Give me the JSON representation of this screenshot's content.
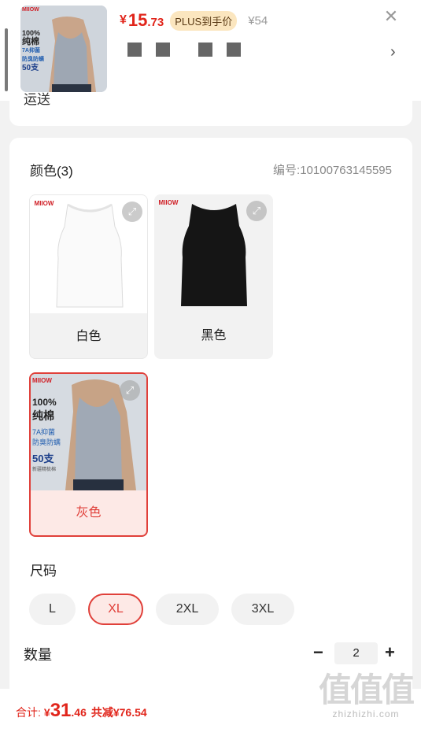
{
  "header": {
    "price_currency": "¥",
    "price_int": "15",
    "price_dec": ".73",
    "plus_tag": "PLUS到手价",
    "original_price": "¥54",
    "close_icon": "close-icon",
    "chevron_icon": "chevron-right-icon",
    "cut_text": "运送"
  },
  "thumb": {
    "brand": "MIIOW",
    "text_100": "100%",
    "text_cotton": "纯棉",
    "text_7a": "7A抑菌",
    "text_anti": "防臭防螨",
    "text_50": "50支",
    "text_new": "新疆精梳棉"
  },
  "color_section": {
    "title": "颜色(3)",
    "code": "编号:10100763145595",
    "options": [
      {
        "label": "白色",
        "selected": false
      },
      {
        "label": "黑色",
        "selected": false
      },
      {
        "label": "灰色",
        "selected": true
      }
    ]
  },
  "size_section": {
    "title": "尺码",
    "options": [
      {
        "label": "L",
        "selected": false
      },
      {
        "label": "XL",
        "selected": true
      },
      {
        "label": "2XL",
        "selected": false
      },
      {
        "label": "3XL",
        "selected": false
      }
    ]
  },
  "quantity": {
    "label": "数量",
    "value": "2",
    "minus": "−",
    "plus": "+"
  },
  "footer": {
    "total_label": "合计:",
    "currency": "¥",
    "total_int": "31",
    "total_dec": ".46",
    "save_text": "共减¥76.54"
  },
  "watermark": {
    "logo": "值值值",
    "url": "zhizhizhi.com"
  },
  "colors": {
    "accent": "#e1251b",
    "selected_border": "#e0403a",
    "selected_bg": "#fde9e6"
  }
}
